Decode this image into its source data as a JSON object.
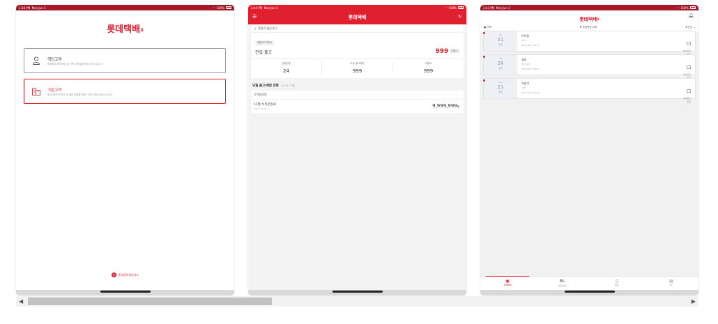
{
  "status": {
    "time_a": "2:38 PM",
    "day": "Mon Jun 3",
    "time_b": "2:40 PM",
    "time_c": "2:43 PM",
    "battery": "100%"
  },
  "screen1": {
    "logo": "롯데택배",
    "personal": {
      "title": "개인고객",
      "desc": "배송조회·예약배송 등 개인고객님을 위한 서비스입니다"
    },
    "corporate": {
      "title": "기업고객",
      "desc": "회사(점포)관리자 및 배송 현황을 위한 기업고객님 서비스입니다"
    },
    "footer": "롯데글로벌로지스"
  },
  "screen2": {
    "title": "롯데택배",
    "notice": "알림이 없습니다.",
    "store_tag": "회원(STORE)",
    "outbound_label": "전일 출고",
    "outbound_value": "999",
    "outbound_badge": "미출고",
    "stats": [
      {
        "label": "전일반품",
        "value": "24"
      },
      {
        "label": "오늘 출고예정",
        "value": "999"
      },
      {
        "label": "미출고",
        "value": "999"
      }
    ],
    "section_title": "당월 출고/배달 현황",
    "section_sub": "(2019.11월)",
    "group_label": "고객분류명",
    "accum_label": "11월 누적운송료",
    "accum_sub": "(2019.11.01~)",
    "accum_value": "9,999,999",
    "accum_unit": "원"
  },
  "screen3": {
    "logo": "롯데택배",
    "filter_label": "선택",
    "search_label": "송장번호 입력",
    "sort_label": "최근순",
    "items": [
      {
        "month": "06",
        "day": "01",
        "status": "집화",
        "name": "이이완",
        "sub": "배*각",
        "track": "6057-9827-1924",
        "state": "배송완료",
        "state2": "12/4배송"
      },
      {
        "month": "06",
        "day": "26",
        "status": "집화",
        "name": "생성",
        "sub": "HP 프린터",
        "track": "2309-6413-0805",
        "state": "배송완료",
        "state2": "완료"
      },
      {
        "month": "03",
        "day": "21",
        "status": "집화",
        "name": "가슴가",
        "sub": "의약",
        "track": "2372-6413-0794",
        "state": "배송완료",
        "state2": "완료"
      }
    ],
    "tabs": [
      "택배예약",
      "송장번호",
      "배송",
      "게시"
    ]
  }
}
